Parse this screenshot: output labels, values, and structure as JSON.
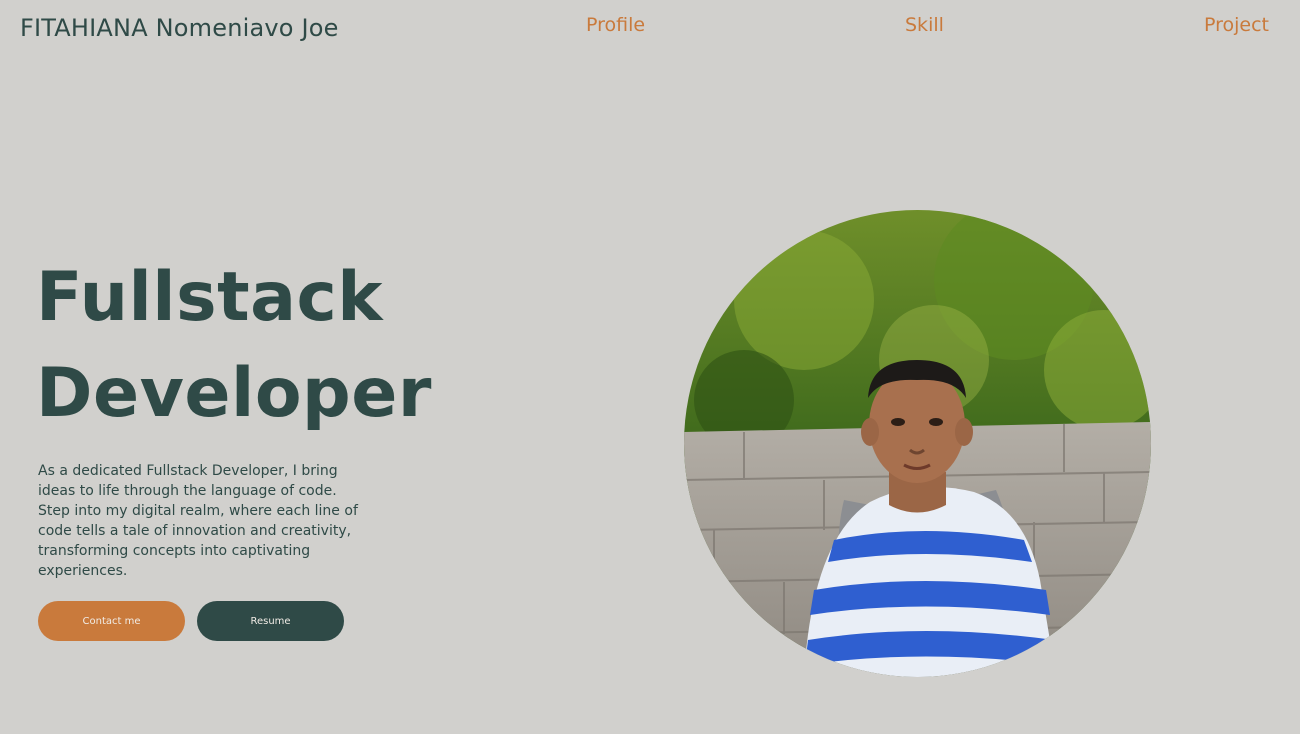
{
  "header": {
    "brand": "FITAHIANA Nomeniavo Joe",
    "nav": {
      "profile": "Profile",
      "skill": "Skill",
      "project": "Project"
    }
  },
  "hero": {
    "title_line1": "Fullstack",
    "title_line2": "Developer",
    "intro_p1": "As a dedicated Fullstack Developer, I bring ideas to life through the language of code.",
    "intro_p2": "Step into my digital realm, where each line of code tells a tale of innovation and creativity, transforming concepts into captivating experiences.",
    "contact_label": "Contact me",
    "resume_label": "Resume"
  },
  "colors": {
    "background": "#d1d0cd",
    "primary_dark": "#2f4a47",
    "accent_orange": "#c97a3c"
  },
  "portrait": {
    "icon": "profile-photo"
  }
}
